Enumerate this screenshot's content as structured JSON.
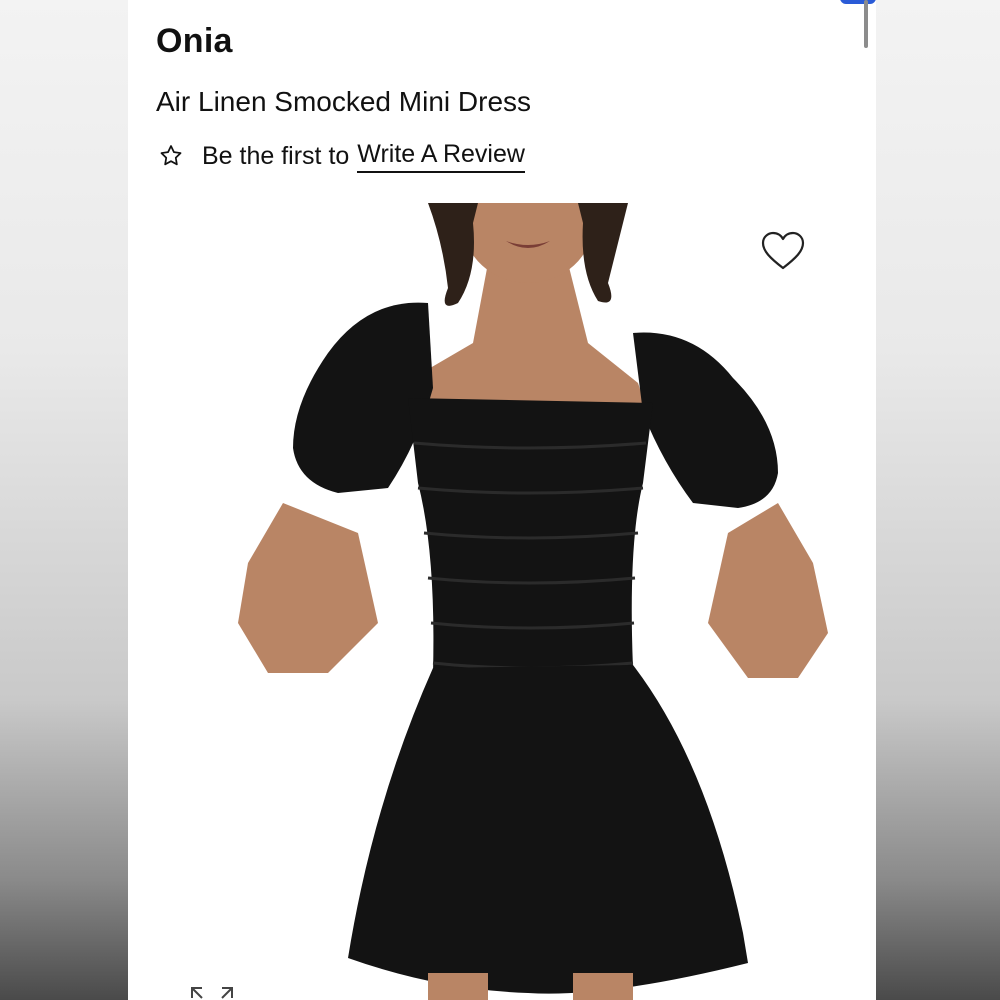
{
  "product": {
    "brand": "Onia",
    "title": "Air Linen Smocked Mini Dress",
    "review_prefix": "Be the first to",
    "review_link": "Write A Review",
    "image_alt": "Air Linen Smocked Mini Dress"
  },
  "icons": {
    "star": "star-outline-icon",
    "heart": "heart-outline-icon",
    "expand": "expand-icon"
  },
  "colors": {
    "text": "#111111",
    "dress": "#131313",
    "skin": "#b98565",
    "hair": "#2e2119",
    "accent": "#2a5bd7"
  }
}
